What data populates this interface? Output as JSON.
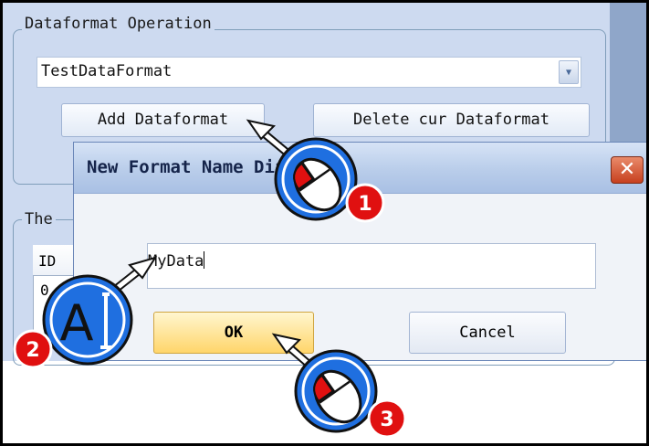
{
  "dataformat_group": {
    "title": "Dataformat Operation",
    "combo_value": "TestDataFormat",
    "combo_arrow_icon": "chevron-down-icon",
    "add_button": "Add Dataformat",
    "delete_button": "Delete cur Dataformat"
  },
  "the_group": {
    "title": "The",
    "list_header": "ID",
    "list_row": "0"
  },
  "dialog": {
    "title": "New Format Name Dialog",
    "input_value": "MyData",
    "ok_label": "OK",
    "cancel_label": "Cancel",
    "close_icon": "close-icon"
  },
  "annotations": {
    "step1": "1",
    "step2": "2",
    "step3": "3",
    "keyboard_icon_letter": "A",
    "accent_blue": "#1f6fe0",
    "badge_red": "#e01010"
  }
}
